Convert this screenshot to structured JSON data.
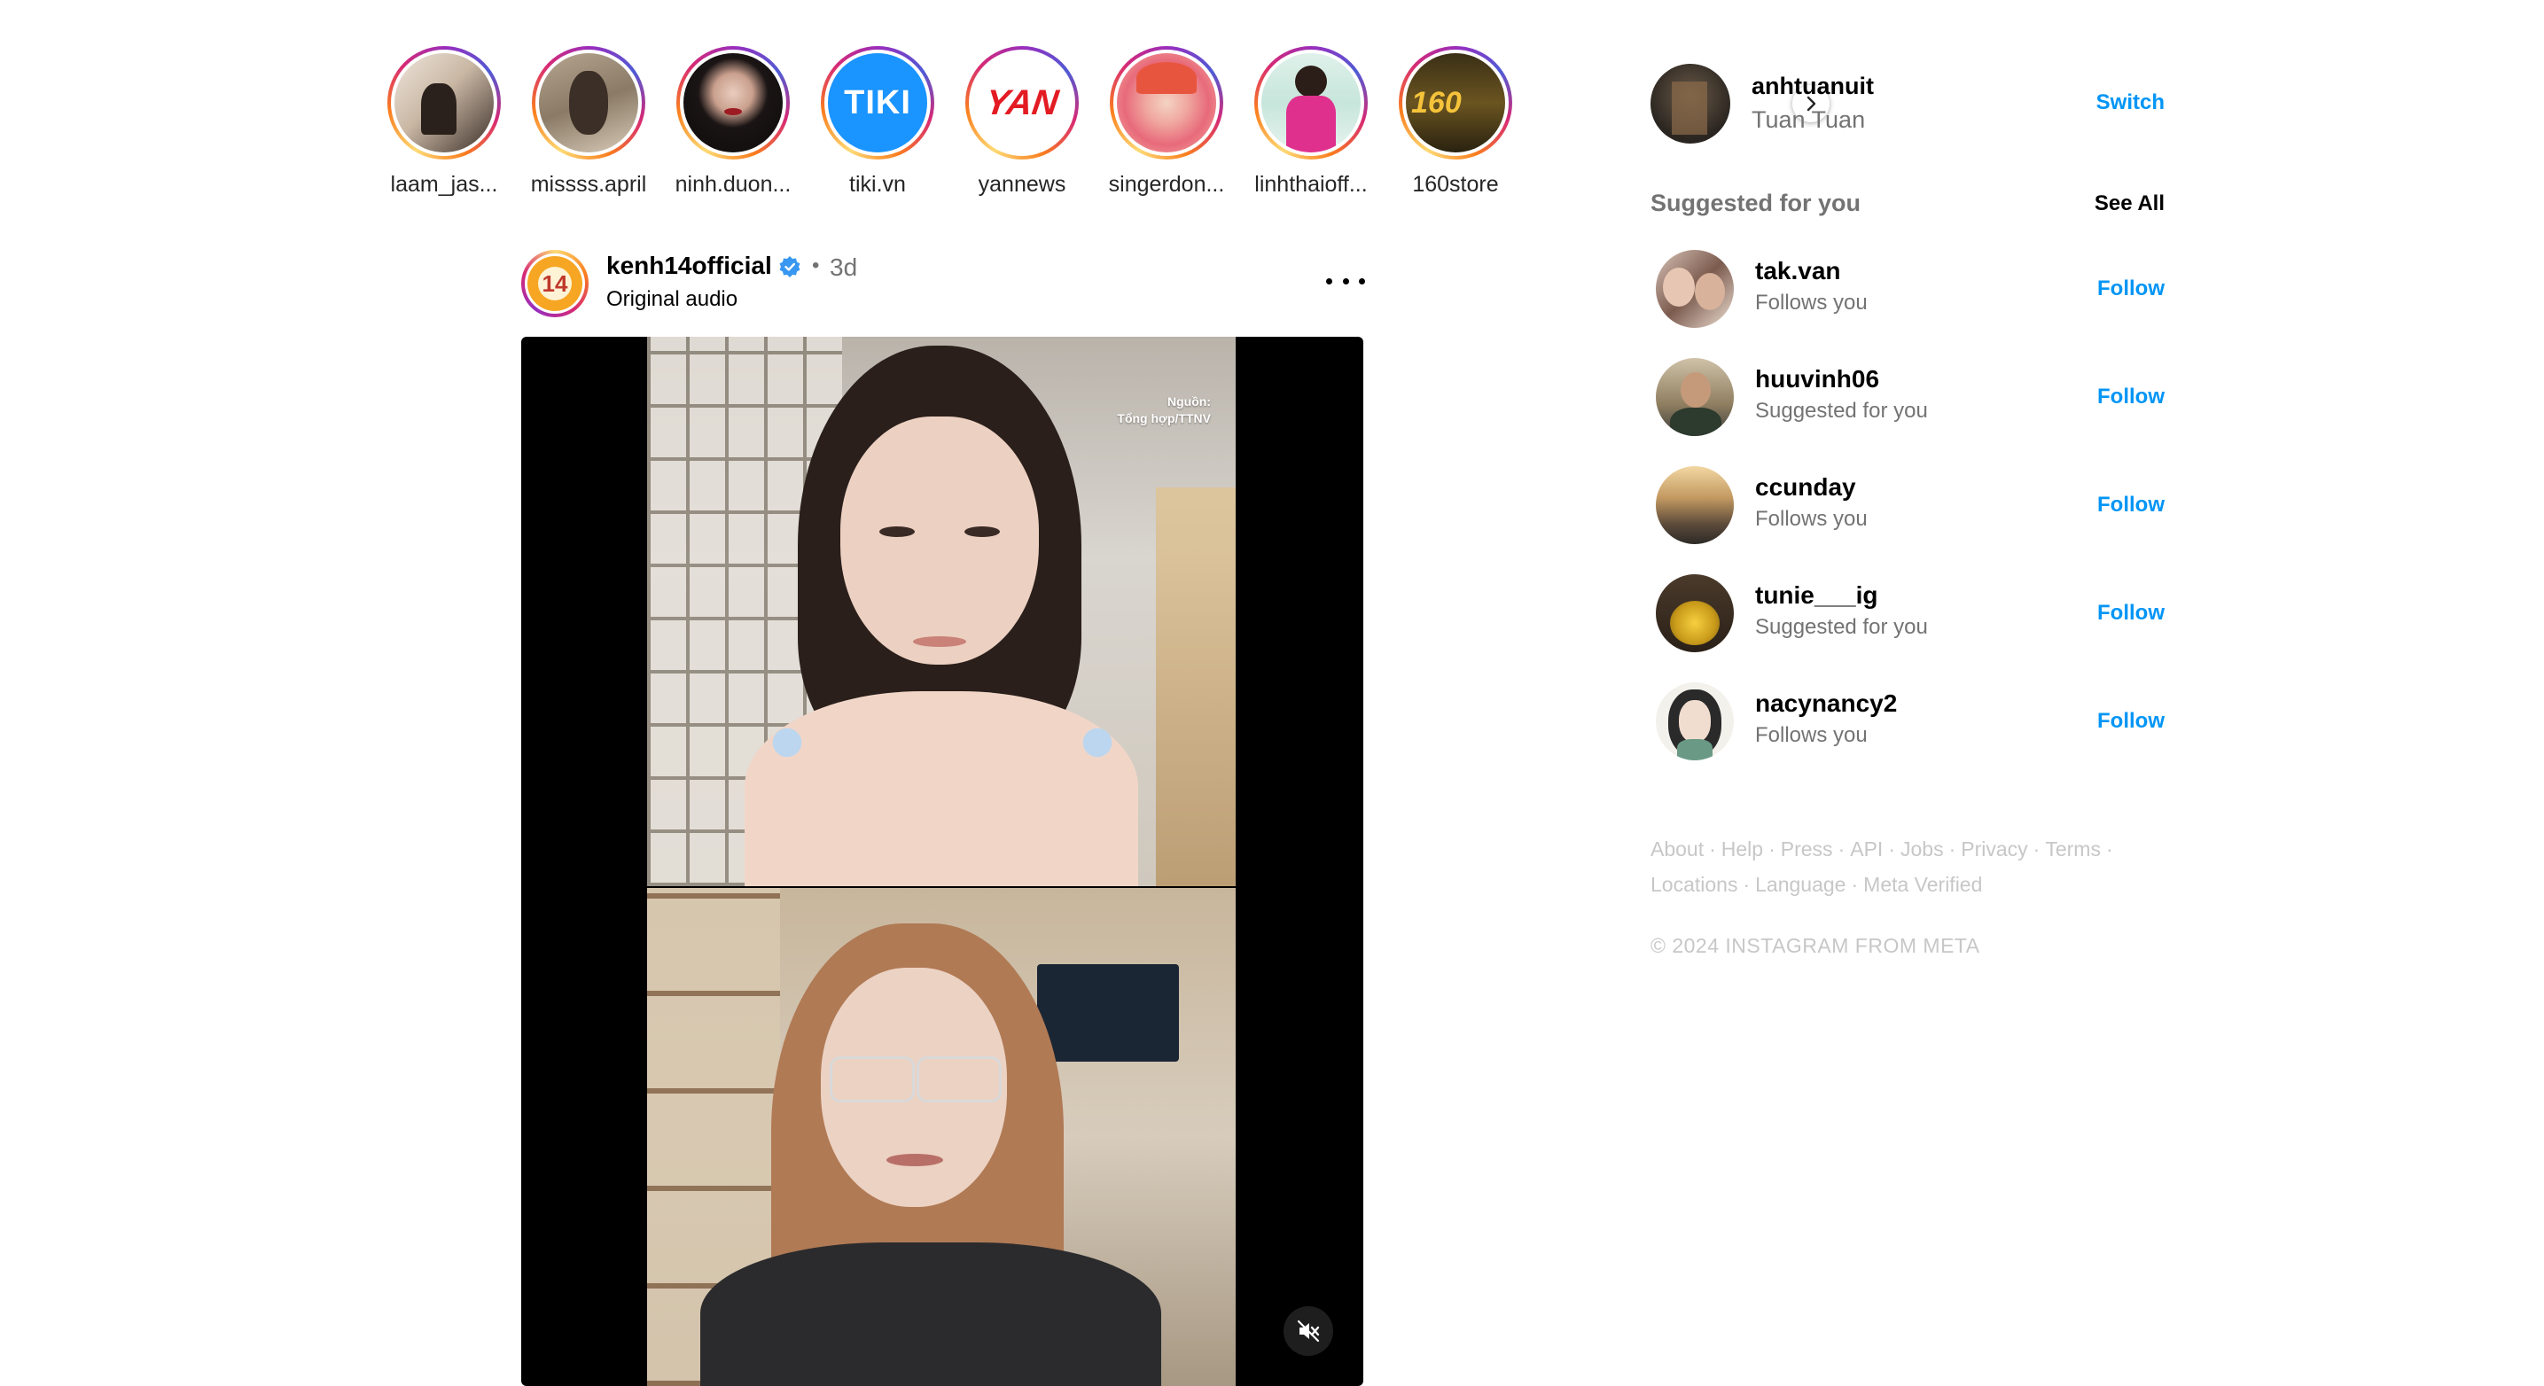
{
  "stories": [
    {
      "username": "laam_jas..."
    },
    {
      "username": "missss.april"
    },
    {
      "username": "ninh.duon..."
    },
    {
      "username": "tiki.vn",
      "logo_text": "TIKI"
    },
    {
      "username": "yannews",
      "logo_text": "YAN"
    },
    {
      "username": "singerdon..."
    },
    {
      "username": "linhthaioff..."
    },
    {
      "username": "160store",
      "logo_text": "160"
    }
  ],
  "post": {
    "username": "kenh14official",
    "dot": "•",
    "time": "3d",
    "audio": "Original audio",
    "avatar_logo_text": "14",
    "source_line1": "Nguồn:",
    "source_line2": "Tổng hợp/TTNV"
  },
  "profile": {
    "username": "anhtuanuit",
    "name": "Tuan Tuan",
    "switch_label": "Switch"
  },
  "suggestions_header": {
    "title": "Suggested for you",
    "see_all": "See All"
  },
  "suggestions": [
    {
      "username": "tak.van",
      "subtitle": "Follows you",
      "action": "Follow"
    },
    {
      "username": "huuvinh06",
      "subtitle": "Suggested for you",
      "action": "Follow"
    },
    {
      "username": "ccunday",
      "subtitle": "Follows you",
      "action": "Follow"
    },
    {
      "username": "tunie___ig",
      "subtitle": "Suggested for you",
      "action": "Follow"
    },
    {
      "username": "nacynancy2",
      "subtitle": "Follows you",
      "action": "Follow"
    }
  ],
  "footer": {
    "links": [
      "About",
      "Help",
      "Press",
      "API",
      "Jobs",
      "Privacy",
      "Terms",
      "Locations",
      "Language",
      "Meta Verified"
    ],
    "separator": "·",
    "copyright": "© 2024 INSTAGRAM FROM META"
  },
  "colors": {
    "link_blue": "#0095f6",
    "secondary_text": "#737373",
    "footer_text": "#c7c7c7",
    "verified_blue": "#3897f0",
    "tiki_blue": "#1a94ff",
    "yan_red": "#e31b23"
  }
}
